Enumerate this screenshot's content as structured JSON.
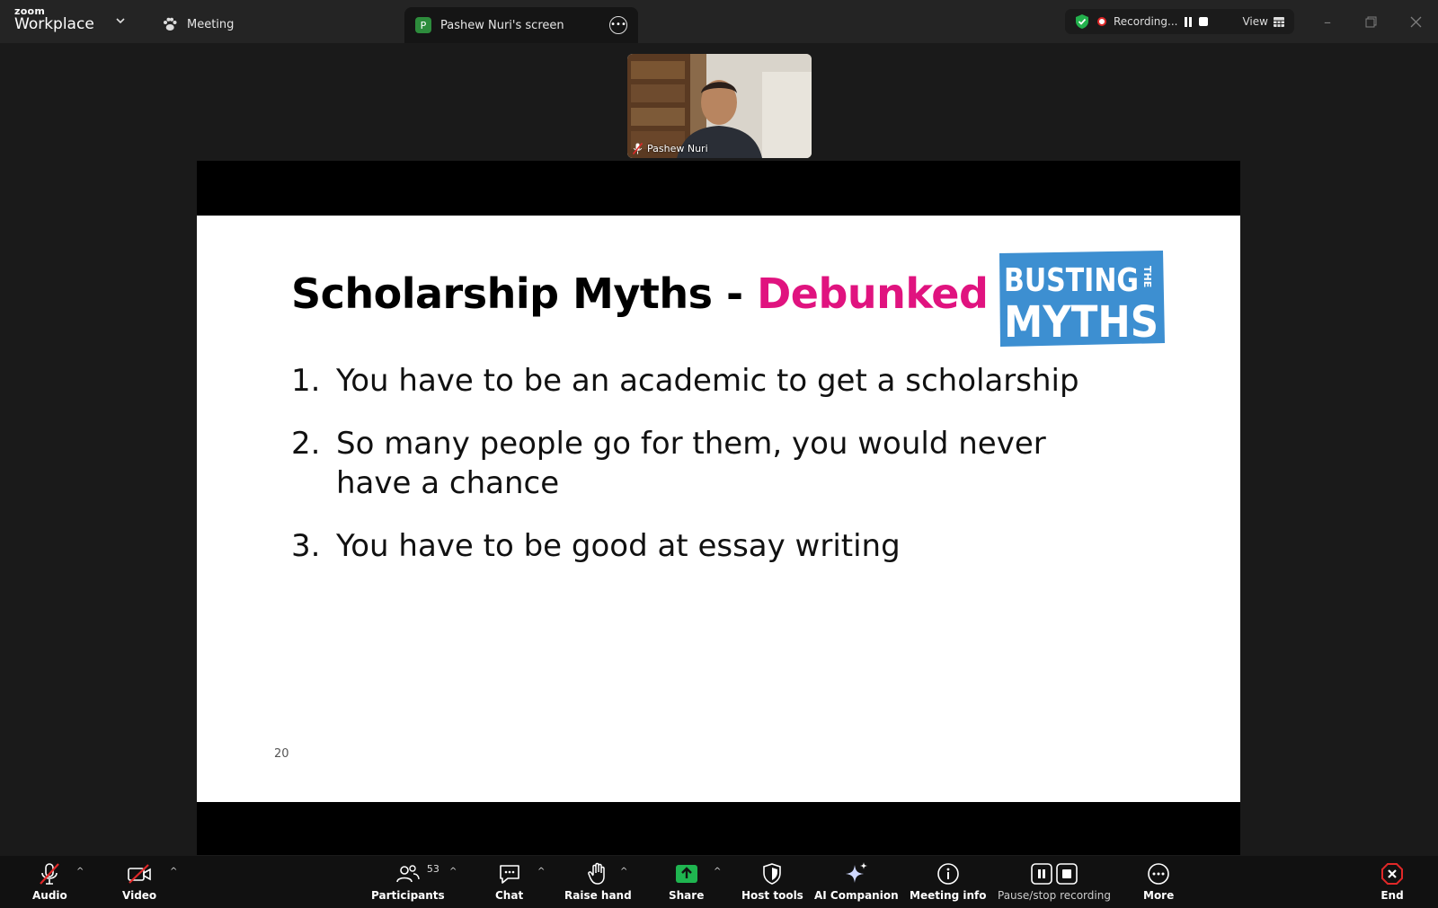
{
  "app": {
    "brand_small": "zoom",
    "brand_large": "Workplace"
  },
  "tabs": {
    "meeting_label": "Meeting",
    "screen_badge": "P",
    "screen_label": "Pashew Nuri's screen"
  },
  "recording": {
    "label": "Recording...",
    "view_label": "View"
  },
  "participant": {
    "name": "Pashew Nuri"
  },
  "slide": {
    "title_main": "Scholarship Myths - ",
    "title_highlight": "Debunked",
    "logo_line1": "BUSTING",
    "logo_the": "THE",
    "logo_line2": "MYTHS",
    "items": [
      {
        "num": "1.",
        "text": "You have to be an academic to get a scholarship"
      },
      {
        "num": "2.",
        "text": "So many people go for them, you would never have a chance"
      },
      {
        "num": "3.",
        "text": "You have to be good at essay writing"
      }
    ],
    "page_number": "20"
  },
  "toolbar": {
    "audio": "Audio",
    "video": "Video",
    "participants": "Participants",
    "participants_count": "53",
    "chat": "Chat",
    "raise_hand": "Raise hand",
    "share": "Share",
    "host_tools": "Host tools",
    "ai_companion": "AI Companion",
    "meeting_info": "Meeting info",
    "pause_stop": "Pause/stop recording",
    "more": "More",
    "end": "End"
  },
  "colors": {
    "accent_pink": "#e0137f",
    "logo_blue": "#3d8fd1",
    "share_green": "#1fb550",
    "end_red": "#e02828"
  }
}
